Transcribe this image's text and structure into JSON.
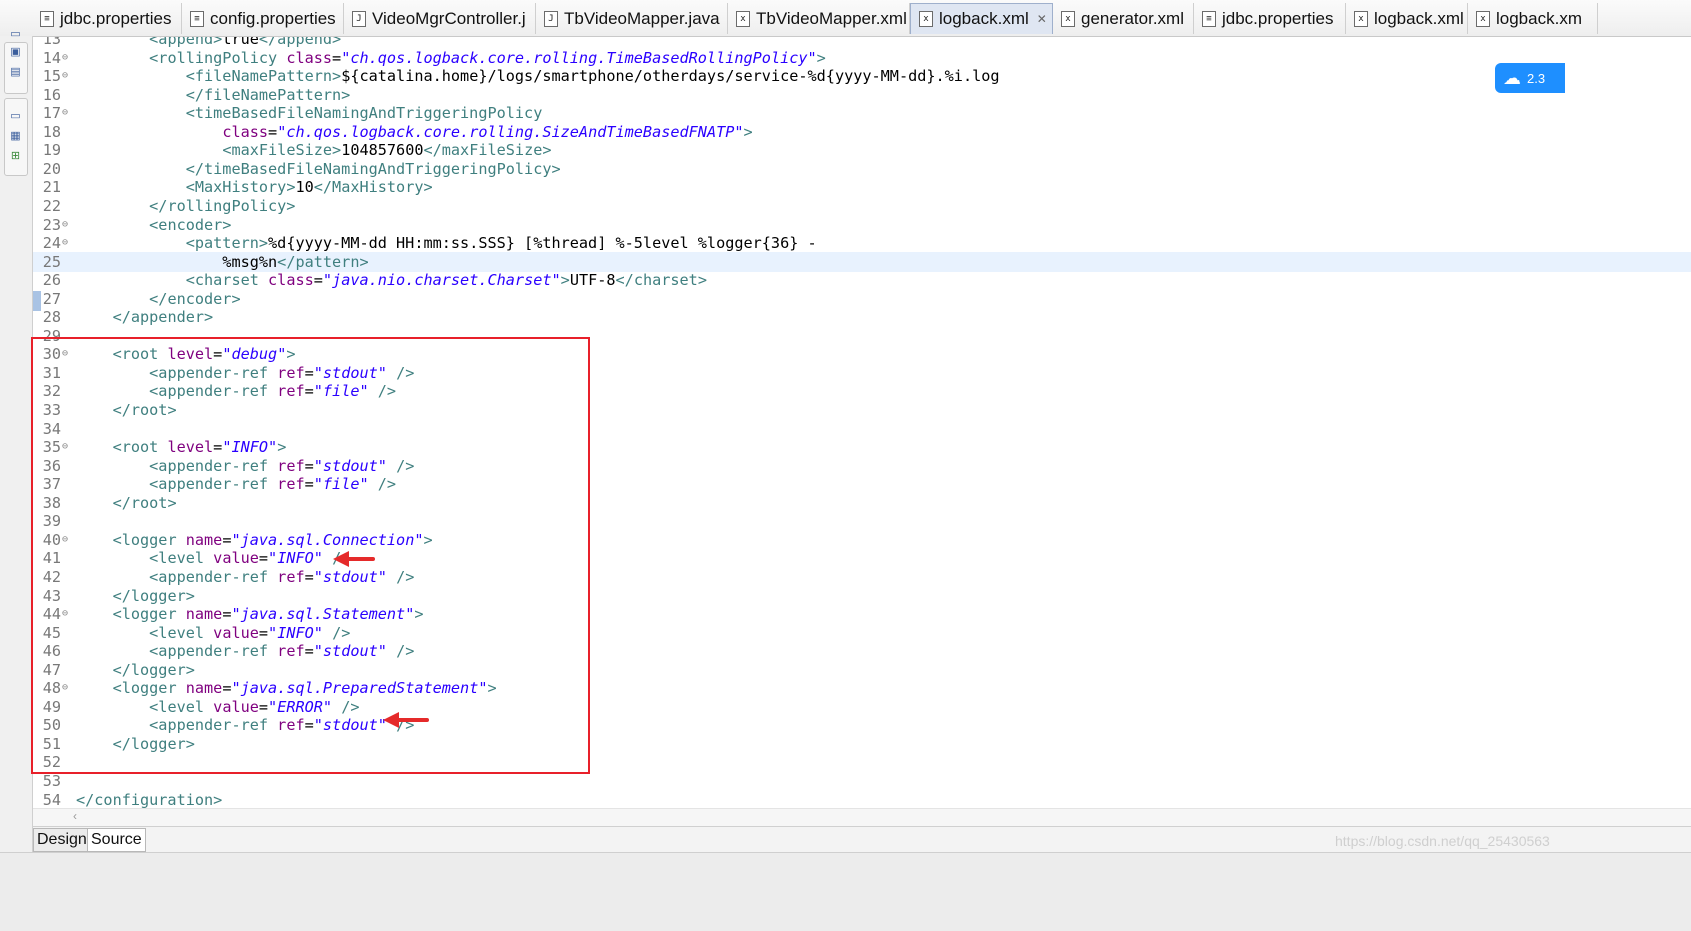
{
  "tabs": [
    {
      "label": "jdbc.properties",
      "icon": "properties-file-icon",
      "left": 0
    },
    {
      "label": "config.properties",
      "icon": "properties-file-icon"
    },
    {
      "label": "VideoMgrController.j",
      "icon": "java-file-icon"
    },
    {
      "label": "TbVideoMapper.java",
      "icon": "java-file-icon"
    },
    {
      "label": "TbVideoMapper.xml",
      "icon": "xml-file-icon"
    },
    {
      "label": "logback.xml",
      "icon": "xml-file-icon",
      "active": true
    },
    {
      "label": "generator.xml",
      "icon": "xml-file-icon"
    },
    {
      "label": "jdbc.properties",
      "icon": "properties-file-icon"
    },
    {
      "label": "logback.xml",
      "icon": "xml-file-icon"
    },
    {
      "label": "logback.xm",
      "icon": "xml-file-icon"
    }
  ],
  "editor": {
    "current_line": 25,
    "lines": [
      {
        "n": "13",
        "fold": false,
        "segs": [
          [
            "x",
            "        "
          ],
          [
            "t",
            "<append>"
          ],
          [
            "x",
            "true"
          ],
          [
            "t",
            "</append>"
          ]
        ]
      },
      {
        "n": "14",
        "fold": true,
        "segs": [
          [
            "x",
            "        "
          ],
          [
            "t",
            "<rollingPolicy "
          ],
          [
            "a",
            "class"
          ],
          [
            "x",
            "="
          ],
          [
            "v",
            "\"ch.qos.logback.core.rolling.TimeBasedRollingPolicy\""
          ],
          [
            "t",
            ">"
          ]
        ]
      },
      {
        "n": "15",
        "fold": true,
        "segs": [
          [
            "x",
            "            "
          ],
          [
            "t",
            "<fileNamePattern>"
          ],
          [
            "x",
            "${catalina.home}/logs/smartphone/otherdays/service-%d{yyyy-MM-dd}.%i.log"
          ]
        ]
      },
      {
        "n": "16",
        "fold": false,
        "segs": [
          [
            "x",
            "            "
          ],
          [
            "t",
            "</fileNamePattern>"
          ]
        ]
      },
      {
        "n": "17",
        "fold": true,
        "segs": [
          [
            "x",
            "            "
          ],
          [
            "t",
            "<timeBasedFileNamingAndTriggeringPolicy"
          ]
        ]
      },
      {
        "n": "18",
        "fold": false,
        "segs": [
          [
            "x",
            "                "
          ],
          [
            "a",
            "class"
          ],
          [
            "x",
            "="
          ],
          [
            "v",
            "\"ch.qos.logback.core.rolling.SizeAndTimeBasedFNATP\""
          ],
          [
            "t",
            ">"
          ]
        ]
      },
      {
        "n": "19",
        "fold": false,
        "segs": [
          [
            "x",
            "                "
          ],
          [
            "t",
            "<maxFileSize>"
          ],
          [
            "x",
            "104857600"
          ],
          [
            "t",
            "</maxFileSize>"
          ]
        ]
      },
      {
        "n": "20",
        "fold": false,
        "segs": [
          [
            "x",
            "            "
          ],
          [
            "t",
            "</timeBasedFileNamingAndTriggeringPolicy>"
          ]
        ]
      },
      {
        "n": "21",
        "fold": false,
        "segs": [
          [
            "x",
            "            "
          ],
          [
            "t",
            "<MaxHistory>"
          ],
          [
            "x",
            "10"
          ],
          [
            "t",
            "</MaxHistory>"
          ]
        ]
      },
      {
        "n": "22",
        "fold": false,
        "segs": [
          [
            "x",
            "        "
          ],
          [
            "t",
            "</rollingPolicy>"
          ]
        ]
      },
      {
        "n": "23",
        "fold": true,
        "segs": [
          [
            "x",
            "        "
          ],
          [
            "t",
            "<encoder>"
          ]
        ]
      },
      {
        "n": "24",
        "fold": true,
        "segs": [
          [
            "x",
            "            "
          ],
          [
            "t",
            "<pattern>"
          ],
          [
            "x",
            "%d{yyyy-MM-dd HH:mm:ss.SSS} [%thread] %-5level %logger{36} -"
          ]
        ]
      },
      {
        "n": "25",
        "fold": false,
        "segs": [
          [
            "x",
            "                %msg%n"
          ],
          [
            "t",
            "</pattern>"
          ]
        ]
      },
      {
        "n": "26",
        "fold": false,
        "segs": [
          [
            "x",
            "            "
          ],
          [
            "t",
            "<charset "
          ],
          [
            "a",
            "class"
          ],
          [
            "x",
            "="
          ],
          [
            "v",
            "\"java.nio.charset.Charset\""
          ],
          [
            "t",
            ">"
          ],
          [
            "x",
            "UTF-8"
          ],
          [
            "t",
            "</charset>"
          ]
        ]
      },
      {
        "n": "27",
        "fold": false,
        "segs": [
          [
            "x",
            "        "
          ],
          [
            "t",
            "</encoder>"
          ]
        ]
      },
      {
        "n": "28",
        "fold": false,
        "segs": [
          [
            "x",
            "    "
          ],
          [
            "t",
            "</appender>"
          ]
        ]
      },
      {
        "n": "29",
        "fold": false,
        "segs": []
      },
      {
        "n": "30",
        "fold": true,
        "segs": [
          [
            "x",
            "    "
          ],
          [
            "t",
            "<root "
          ],
          [
            "a",
            "level"
          ],
          [
            "x",
            "="
          ],
          [
            "v",
            "\"debug\""
          ],
          [
            "t",
            ">"
          ]
        ]
      },
      {
        "n": "31",
        "fold": false,
        "segs": [
          [
            "x",
            "        "
          ],
          [
            "t",
            "<appender-ref "
          ],
          [
            "a",
            "ref"
          ],
          [
            "x",
            "="
          ],
          [
            "v",
            "\"stdout\""
          ],
          [
            "t",
            " />"
          ]
        ]
      },
      {
        "n": "32",
        "fold": false,
        "segs": [
          [
            "x",
            "        "
          ],
          [
            "t",
            "<appender-ref "
          ],
          [
            "a",
            "ref"
          ],
          [
            "x",
            "="
          ],
          [
            "v",
            "\"file\""
          ],
          [
            "t",
            " />"
          ]
        ]
      },
      {
        "n": "33",
        "fold": false,
        "segs": [
          [
            "x",
            "    "
          ],
          [
            "t",
            "</root>"
          ]
        ]
      },
      {
        "n": "34",
        "fold": false,
        "segs": []
      },
      {
        "n": "35",
        "fold": true,
        "segs": [
          [
            "x",
            "    "
          ],
          [
            "t",
            "<root "
          ],
          [
            "a",
            "level"
          ],
          [
            "x",
            "="
          ],
          [
            "v",
            "\"INFO\""
          ],
          [
            "t",
            ">"
          ]
        ]
      },
      {
        "n": "36",
        "fold": false,
        "segs": [
          [
            "x",
            "        "
          ],
          [
            "t",
            "<appender-ref "
          ],
          [
            "a",
            "ref"
          ],
          [
            "x",
            "="
          ],
          [
            "v",
            "\"stdout\""
          ],
          [
            "t",
            " />"
          ]
        ]
      },
      {
        "n": "37",
        "fold": false,
        "segs": [
          [
            "x",
            "        "
          ],
          [
            "t",
            "<appender-ref "
          ],
          [
            "a",
            "ref"
          ],
          [
            "x",
            "="
          ],
          [
            "v",
            "\"file\""
          ],
          [
            "t",
            " />"
          ]
        ]
      },
      {
        "n": "38",
        "fold": false,
        "segs": [
          [
            "x",
            "    "
          ],
          [
            "t",
            "</root>"
          ]
        ]
      },
      {
        "n": "39",
        "fold": false,
        "segs": []
      },
      {
        "n": "40",
        "fold": true,
        "segs": [
          [
            "x",
            "    "
          ],
          [
            "t",
            "<logger "
          ],
          [
            "a",
            "name"
          ],
          [
            "x",
            "="
          ],
          [
            "v",
            "\"java.sql.Connection\""
          ],
          [
            "t",
            ">"
          ]
        ]
      },
      {
        "n": "41",
        "fold": false,
        "segs": [
          [
            "x",
            "        "
          ],
          [
            "t",
            "<level "
          ],
          [
            "a",
            "value"
          ],
          [
            "x",
            "="
          ],
          [
            "v",
            "\"INFO\""
          ],
          [
            "t",
            " />"
          ]
        ]
      },
      {
        "n": "42",
        "fold": false,
        "segs": [
          [
            "x",
            "        "
          ],
          [
            "t",
            "<appender-ref "
          ],
          [
            "a",
            "ref"
          ],
          [
            "x",
            "="
          ],
          [
            "v",
            "\"stdout\""
          ],
          [
            "t",
            " />"
          ]
        ]
      },
      {
        "n": "43",
        "fold": false,
        "segs": [
          [
            "x",
            "    "
          ],
          [
            "t",
            "</logger>"
          ]
        ]
      },
      {
        "n": "44",
        "fold": true,
        "segs": [
          [
            "x",
            "    "
          ],
          [
            "t",
            "<logger "
          ],
          [
            "a",
            "name"
          ],
          [
            "x",
            "="
          ],
          [
            "v",
            "\"java.sql.Statement\""
          ],
          [
            "t",
            ">"
          ]
        ]
      },
      {
        "n": "45",
        "fold": false,
        "segs": [
          [
            "x",
            "        "
          ],
          [
            "t",
            "<level "
          ],
          [
            "a",
            "value"
          ],
          [
            "x",
            "="
          ],
          [
            "v",
            "\"INFO\""
          ],
          [
            "t",
            " />"
          ]
        ]
      },
      {
        "n": "46",
        "fold": false,
        "segs": [
          [
            "x",
            "        "
          ],
          [
            "t",
            "<appender-ref "
          ],
          [
            "a",
            "ref"
          ],
          [
            "x",
            "="
          ],
          [
            "v",
            "\"stdout\""
          ],
          [
            "t",
            " />"
          ]
        ]
      },
      {
        "n": "47",
        "fold": false,
        "segs": [
          [
            "x",
            "    "
          ],
          [
            "t",
            "</logger>"
          ]
        ]
      },
      {
        "n": "48",
        "fold": true,
        "segs": [
          [
            "x",
            "    "
          ],
          [
            "t",
            "<logger "
          ],
          [
            "a",
            "name"
          ],
          [
            "x",
            "="
          ],
          [
            "v",
            "\"java.sql.PreparedStatement\""
          ],
          [
            "t",
            ">"
          ]
        ]
      },
      {
        "n": "49",
        "fold": false,
        "segs": [
          [
            "x",
            "        "
          ],
          [
            "t",
            "<level "
          ],
          [
            "a",
            "value"
          ],
          [
            "x",
            "="
          ],
          [
            "v",
            "\"ERROR\""
          ],
          [
            "t",
            " />"
          ]
        ]
      },
      {
        "n": "50",
        "fold": false,
        "segs": [
          [
            "x",
            "        "
          ],
          [
            "t",
            "<appender-ref "
          ],
          [
            "a",
            "ref"
          ],
          [
            "x",
            "="
          ],
          [
            "v",
            "\"stdout\""
          ],
          [
            "t",
            " />"
          ]
        ]
      },
      {
        "n": "51",
        "fold": false,
        "segs": [
          [
            "x",
            "    "
          ],
          [
            "t",
            "</logger>"
          ]
        ]
      },
      {
        "n": "52",
        "fold": false,
        "segs": []
      },
      {
        "n": "53",
        "fold": false,
        "segs": []
      },
      {
        "n": "54",
        "fold": false,
        "segs": [
          [
            "t",
            "</configuration>"
          ]
        ]
      }
    ]
  },
  "bottom_tabs": {
    "design": "Design",
    "source": "Source"
  },
  "widget": {
    "label": "2.3",
    "icon": "baidu-cloud-icon"
  },
  "watermark": "https://blog.csdn.net/qq_25430563",
  "annotations": {
    "highlight_color": "#e8202a",
    "arrow_color": "#e52a2a"
  }
}
